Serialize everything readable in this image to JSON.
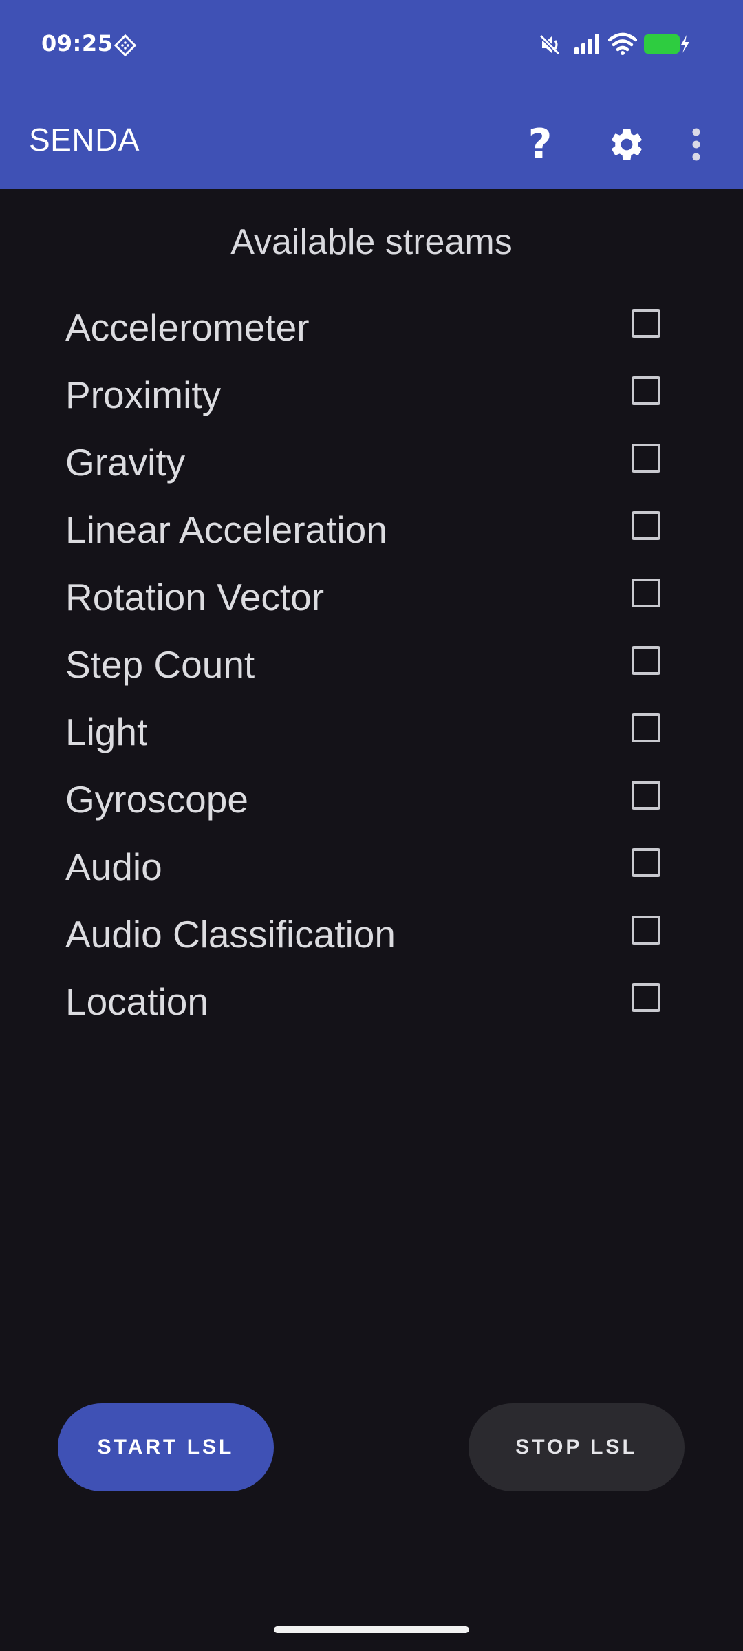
{
  "status_bar": {
    "time": "09:25",
    "icons": [
      "nfc-diamond-icon",
      "mute-icon",
      "cellular-signal-icon",
      "wifi-icon",
      "battery-charging-icon"
    ],
    "battery_color": "#2ecc40"
  },
  "app_bar": {
    "title": "SENDA",
    "actions": [
      "help-icon",
      "settings-gear-icon",
      "overflow-menu-icon"
    ],
    "color": "#3f51b5"
  },
  "streams": {
    "heading": "Available streams",
    "items": [
      {
        "label": "Accelerometer",
        "checked": false
      },
      {
        "label": "Proximity",
        "checked": false
      },
      {
        "label": "Gravity",
        "checked": false
      },
      {
        "label": "Linear Acceleration",
        "checked": false
      },
      {
        "label": "Rotation Vector",
        "checked": false
      },
      {
        "label": "Step Count",
        "checked": false
      },
      {
        "label": "Light",
        "checked": false
      },
      {
        "label": "Gyroscope",
        "checked": false
      },
      {
        "label": "Audio",
        "checked": false
      },
      {
        "label": "Audio Classification",
        "checked": false
      },
      {
        "label": "Location",
        "checked": false
      }
    ]
  },
  "buttons": {
    "start_label": "START LSL",
    "stop_label": "STOP LSL"
  },
  "colors": {
    "background": "#141218",
    "primary": "#3f51b5",
    "secondary_button": "#2b2a2f"
  }
}
